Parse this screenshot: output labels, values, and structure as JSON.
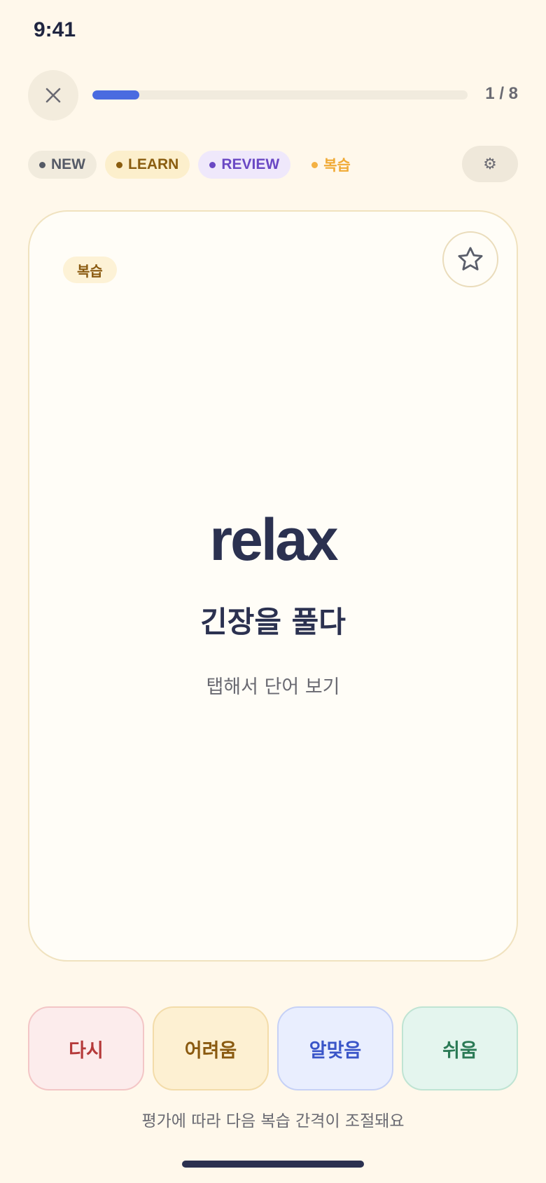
{
  "status_bar": {
    "time": "9:41"
  },
  "header": {
    "progress_count": "1 / 8",
    "progress_fraction": 0.125
  },
  "filters": {
    "new": "NEW",
    "learn": "LEARN",
    "review": "REVIEW",
    "relearn": "복습",
    "settings_icon": "⚙"
  },
  "card": {
    "badge": "복습",
    "word": "relax",
    "meaning": "긴장을 풀다",
    "hint": "탭해서 단어 보기"
  },
  "ratings": {
    "again": "다시",
    "hard": "어려움",
    "good": "알맞음",
    "easy": "쉬움"
  },
  "footer": {
    "note": "평가에 따라 다음 복습 간격이 조절돼요"
  },
  "colors": {
    "accent": "#4a6be0",
    "background": "#fff8eb",
    "again": "#b53a3a",
    "hard": "#8a5a10",
    "good": "#3a55c8",
    "easy": "#2a7a55"
  }
}
